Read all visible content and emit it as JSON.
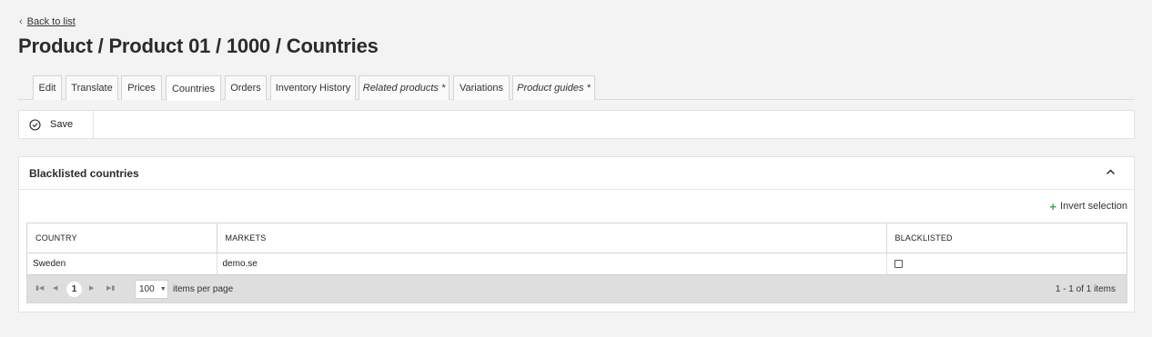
{
  "nav": {
    "back_label": "Back to list"
  },
  "page": {
    "title": "Product / Product 01 / 1000 / Countries"
  },
  "tabs": [
    {
      "label": "Edit"
    },
    {
      "label": "Translate"
    },
    {
      "label": "Prices"
    },
    {
      "label": "Countries"
    },
    {
      "label": "Orders"
    },
    {
      "label": "Inventory History"
    },
    {
      "label": "Related products *"
    },
    {
      "label": "Variations"
    },
    {
      "label": "Product guides *"
    }
  ],
  "toolbar": {
    "save_label": "Save"
  },
  "panel": {
    "title": "Blacklisted countries",
    "invert_label": "Invert selection",
    "columns": {
      "country": "COUNTRY",
      "markets": "MARKETS",
      "blacklisted": "BLACKLISTED"
    },
    "rows": [
      {
        "country": "Sweden",
        "markets": "demo.se",
        "blacklisted": false
      }
    ],
    "pager": {
      "current_page": "1",
      "page_size": "100",
      "items_per_page_label": "items per page",
      "info": "1 - 1 of 1 items"
    }
  },
  "colors": {
    "accent_plus": "#3aa657",
    "background": "#f3f3f3"
  },
  "icons": {
    "back": "chevron-left-icon",
    "save": "check-circle-icon",
    "collapse": "chevron-up-icon",
    "invert": "plus-icon"
  }
}
